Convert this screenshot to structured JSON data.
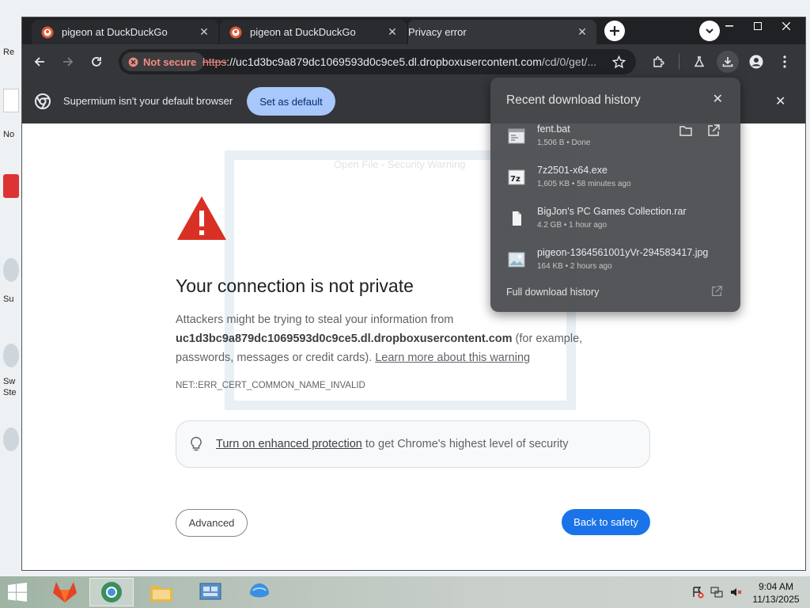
{
  "desktop": {
    "labels": [
      "Re",
      "No",
      "Su",
      "Sw",
      "Ste"
    ]
  },
  "tabs": [
    {
      "title": "pigeon at DuckDuckGo",
      "favicon": "duckduckgo-icon"
    },
    {
      "title": "pigeon at DuckDuckGo",
      "favicon": "duckduckgo-icon"
    },
    {
      "title": "Privacy error",
      "favicon": ""
    }
  ],
  "toolbar": {
    "security_chip": "Not secure",
    "url_scheme": "https",
    "url_host": "://uc1d3bc9a879dc1069593d0c9ce5.dl.dropboxusercontent.com",
    "url_path": "/cd/0/get/..."
  },
  "infobar": {
    "message": "Supermium isn't your default browser",
    "button": "Set as default"
  },
  "ghost_dialog": {
    "title": "Open File - Security Warning"
  },
  "interstitial": {
    "heading": "Your connection is not private",
    "line1": "Attackers might be trying to steal your information from",
    "host": "uc1d3bc9a879dc1069593d0c9ce5.dl.dropboxusercontent.com",
    "line2": " (for example, passwords, messages or credit cards). ",
    "learn_more": "Learn more about this warning",
    "error_code": "NET::ERR_CERT_COMMON_NAME_INVALID",
    "enhanced_link": "Turn on enhanced protection",
    "enhanced_rest": " to get Chrome's highest level of security",
    "advanced_button": "Advanced",
    "safety_button": "Back to safety"
  },
  "downloads": {
    "title": "Recent download history",
    "items": [
      {
        "name": "fent.bat",
        "meta": "1,506 B • Done",
        "icon": "batch-file-icon"
      },
      {
        "name": "7z2501-x64.exe",
        "meta": "1,605 KB • 58 minutes ago",
        "icon": "7zip-icon"
      },
      {
        "name": "BigJon's PC Games Collection.rar",
        "meta": "4.2 GB • 1 hour ago",
        "icon": "document-icon"
      },
      {
        "name": "pigeon-1364561001yVr-294583417.jpg",
        "meta": "164 KB • 2 hours ago",
        "icon": "image-file-icon"
      }
    ],
    "full_history": "Full download history"
  },
  "clock": {
    "time": "9:04 AM",
    "date": "11/13/2025"
  }
}
